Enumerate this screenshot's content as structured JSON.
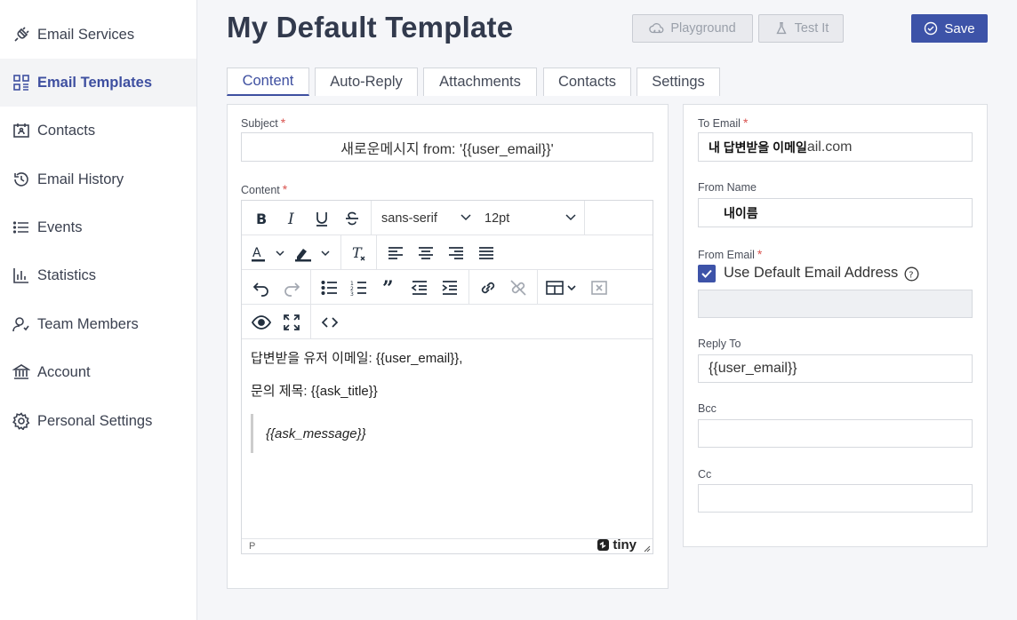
{
  "sidebar": {
    "items": [
      {
        "label": "Email Services",
        "icon": "plug-icon"
      },
      {
        "label": "Email Templates",
        "icon": "templates-icon",
        "active": true
      },
      {
        "label": "Contacts",
        "icon": "contact-card-icon"
      },
      {
        "label": "Email History",
        "icon": "history-icon"
      },
      {
        "label": "Events",
        "icon": "list-icon"
      },
      {
        "label": "Statistics",
        "icon": "bar-chart-icon"
      },
      {
        "label": "Team Members",
        "icon": "team-icon"
      },
      {
        "label": "Account",
        "icon": "bank-icon"
      },
      {
        "label": "Personal Settings",
        "icon": "gear-icon"
      }
    ]
  },
  "header": {
    "title": "My Default Template",
    "playground_label": "Playground",
    "test_label": "Test It",
    "save_label": "Save"
  },
  "tabs": [
    {
      "label": "Content",
      "active": true
    },
    {
      "label": "Auto-Reply"
    },
    {
      "label": "Attachments"
    },
    {
      "label": "Contacts"
    },
    {
      "label": "Settings"
    }
  ],
  "content_panel": {
    "subject_label": "Subject",
    "subject_value": "새로운메시지 from: '{{user_email}}'",
    "content_label": "Content",
    "font_family": "sans-serif",
    "font_size": "12pt",
    "body": {
      "line1": "답변받을 유저 이메일: {{user_email}},",
      "line2": "문의 제목: {{ask_title}}",
      "quote": "{{ask_message}}"
    },
    "status_path": "P",
    "brand": "tiny"
  },
  "settings_panel": {
    "to_email_label": "To Email",
    "to_email_value_a": "내 답변받을 이메일",
    "to_email_value_b": "ail.com",
    "from_name_label": "From Name",
    "from_name_value": "내이름",
    "from_email_label": "From Email",
    "use_default_label": "Use Default Email Address",
    "use_default_checked": true,
    "reply_to_label": "Reply To",
    "reply_to_value": "{{user_email}}",
    "bcc_label": "Bcc",
    "bcc_value": "",
    "cc_label": "Cc",
    "cc_value": ""
  },
  "colors": {
    "accent": "#3d53a8",
    "required": "#d9534f"
  }
}
